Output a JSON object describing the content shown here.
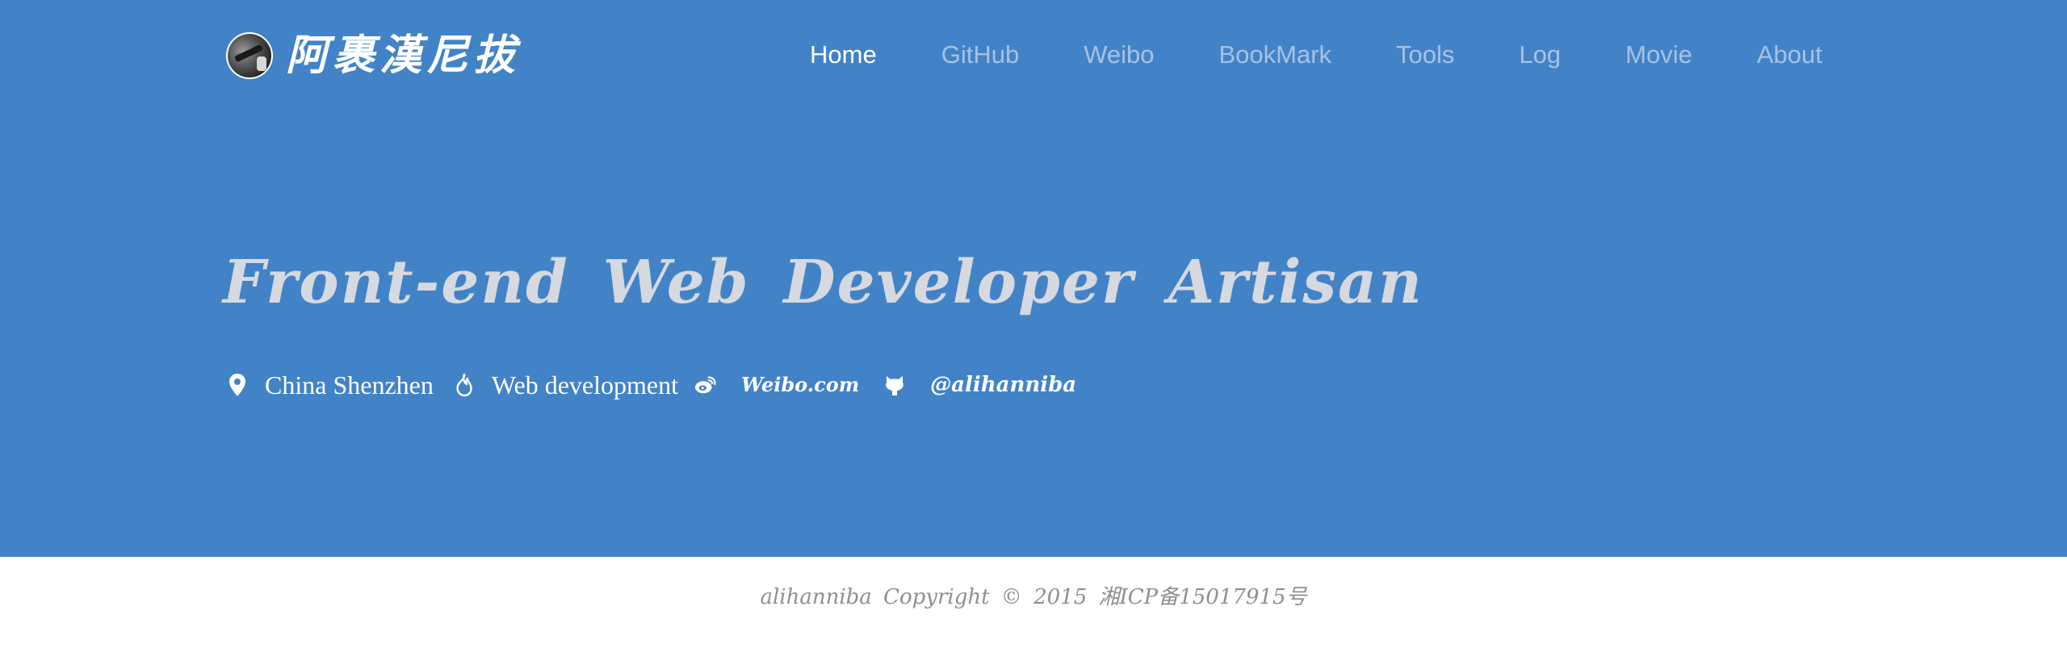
{
  "header": {
    "brand_name": "阿裹漢尼拔",
    "nav": [
      {
        "label": "Home",
        "active": true
      },
      {
        "label": "GitHub",
        "active": false
      },
      {
        "label": "Weibo",
        "active": false
      },
      {
        "label": "BookMark",
        "active": false
      },
      {
        "label": "Tools",
        "active": false
      },
      {
        "label": "Log",
        "active": false
      },
      {
        "label": "Movie",
        "active": false
      },
      {
        "label": "About",
        "active": false
      }
    ]
  },
  "hero": {
    "tagline": "Front-end Web Developer Artisan",
    "info": {
      "location": "China Shenzhen",
      "field": "Web development",
      "weibo": "Weibo.com",
      "github": "@alihanniba"
    }
  },
  "footer": {
    "copyright": "alihanniba Copyright © 2015 湘ICP备15017915号"
  },
  "colors": {
    "hero_bg": "#4283c7",
    "nav_inactive": "#a6c2e4",
    "nav_active": "#ffffff",
    "tagline": "#d6d9df",
    "footer_text": "#8f8f8f"
  },
  "icons": {
    "location": "map-pin-icon",
    "field": "flame-icon",
    "weibo": "weibo-icon",
    "github": "github-icon"
  }
}
